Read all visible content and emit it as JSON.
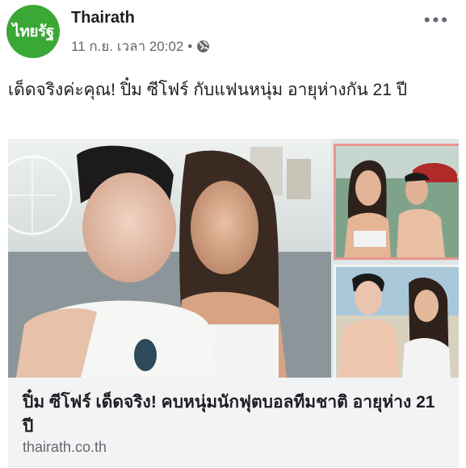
{
  "post": {
    "page_name": "Thairath",
    "avatar_text": "ไทยรัฐ",
    "date": "11 ก.ย. เวลา 20:02",
    "separator": "•",
    "privacy_icon": "globe-icon",
    "more_icon": "more-dots-icon",
    "more_label": "•••",
    "text": "เด็ดจริงค่ะคุณ! ปิ๋ม ซีโฟร์ กับแฟนหนุ่ม อายุห่างกัน 21 ปี"
  },
  "link": {
    "title": "ปิ๋ม ซีโฟร์ เด็ดจริง! คบหนุ่มนักฟุตบอลทีมชาติ อายุห่าง 21 ปี",
    "domain": "thairath.co.th"
  },
  "colors": {
    "brand_green": "#3aa835",
    "meta_gray": "#65676b",
    "link_bg": "#f2f3f5"
  }
}
